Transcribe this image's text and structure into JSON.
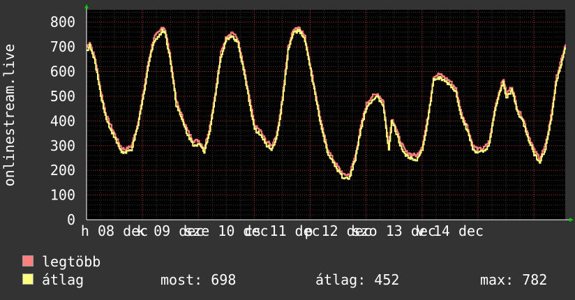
{
  "chart_data": {
    "type": "line",
    "ylabel": "onlinestream.live",
    "ylim": [
      0,
      850
    ],
    "yticks": [
      0,
      100,
      200,
      300,
      400,
      500,
      600,
      700,
      800
    ],
    "xticks": [
      "h 08 dec",
      "k 09 dec",
      "sze 10 dec",
      "cs 11 dec",
      "p 12 dec",
      "szo 13 dec",
      "v 14 dec"
    ],
    "grid": true,
    "series": [
      {
        "name": "legtöbb",
        "color": "#ff7f7f",
        "anchors": [
          [
            0.0,
            700
          ],
          [
            0.05,
            720
          ],
          [
            0.15,
            650
          ],
          [
            0.25,
            520
          ],
          [
            0.35,
            420
          ],
          [
            0.45,
            370
          ],
          [
            0.55,
            320
          ],
          [
            0.62,
            290
          ],
          [
            0.7,
            285
          ],
          [
            0.8,
            300
          ],
          [
            0.9,
            380
          ],
          [
            1.0,
            500
          ],
          [
            1.1,
            640
          ],
          [
            1.2,
            740
          ],
          [
            1.3,
            760
          ],
          [
            1.35,
            785
          ],
          [
            1.4,
            770
          ],
          [
            1.5,
            650
          ],
          [
            1.6,
            480
          ],
          [
            1.7,
            420
          ],
          [
            1.8,
            360
          ],
          [
            1.9,
            320
          ],
          [
            2.0,
            320
          ],
          [
            2.1,
            290
          ],
          [
            2.2,
            380
          ],
          [
            2.3,
            520
          ],
          [
            2.4,
            680
          ],
          [
            2.5,
            745
          ],
          [
            2.6,
            760
          ],
          [
            2.7,
            730
          ],
          [
            2.8,
            620
          ],
          [
            2.9,
            500
          ],
          [
            3.0,
            380
          ],
          [
            3.1,
            360
          ],
          [
            3.2,
            320
          ],
          [
            3.3,
            300
          ],
          [
            3.4,
            350
          ],
          [
            3.5,
            500
          ],
          [
            3.6,
            700
          ],
          [
            3.7,
            775
          ],
          [
            3.8,
            780
          ],
          [
            3.9,
            740
          ],
          [
            4.0,
            620
          ],
          [
            4.1,
            500
          ],
          [
            4.2,
            380
          ],
          [
            4.3,
            290
          ],
          [
            4.4,
            245
          ],
          [
            4.5,
            210
          ],
          [
            4.6,
            180
          ],
          [
            4.7,
            185
          ],
          [
            4.8,
            260
          ],
          [
            4.9,
            380
          ],
          [
            5.0,
            470
          ],
          [
            5.1,
            500
          ],
          [
            5.2,
            510
          ],
          [
            5.3,
            480
          ],
          [
            5.35,
            380
          ],
          [
            5.4,
            300
          ],
          [
            5.45,
            410
          ],
          [
            5.5,
            390
          ],
          [
            5.6,
            320
          ],
          [
            5.7,
            275
          ],
          [
            5.8,
            265
          ],
          [
            5.9,
            260
          ],
          [
            6.0,
            300
          ],
          [
            6.1,
            420
          ],
          [
            6.2,
            580
          ],
          [
            6.3,
            590
          ],
          [
            6.4,
            575
          ],
          [
            6.5,
            560
          ],
          [
            6.6,
            530
          ],
          [
            6.7,
            430
          ],
          [
            6.8,
            380
          ],
          [
            6.9,
            300
          ],
          [
            7.0,
            285
          ],
          [
            7.1,
            290
          ],
          [
            7.2,
            320
          ],
          [
            7.3,
            460
          ],
          [
            7.4,
            540
          ],
          [
            7.45,
            570
          ],
          [
            7.5,
            510
          ],
          [
            7.6,
            540
          ],
          [
            7.7,
            450
          ],
          [
            7.8,
            410
          ],
          [
            7.9,
            340
          ],
          [
            8.0,
            280
          ],
          [
            8.1,
            250
          ],
          [
            8.2,
            300
          ],
          [
            8.3,
            420
          ],
          [
            8.4,
            580
          ],
          [
            8.5,
            660
          ],
          [
            8.56,
            710
          ]
        ]
      },
      {
        "name": "átlag",
        "color": "#ffff7f",
        "anchors": [
          [
            0.0,
            685
          ],
          [
            0.05,
            705
          ],
          [
            0.15,
            635
          ],
          [
            0.25,
            505
          ],
          [
            0.35,
            405
          ],
          [
            0.45,
            355
          ],
          [
            0.55,
            305
          ],
          [
            0.62,
            275
          ],
          [
            0.7,
            270
          ],
          [
            0.8,
            285
          ],
          [
            0.9,
            365
          ],
          [
            1.0,
            485
          ],
          [
            1.1,
            625
          ],
          [
            1.2,
            725
          ],
          [
            1.3,
            745
          ],
          [
            1.35,
            770
          ],
          [
            1.4,
            755
          ],
          [
            1.5,
            635
          ],
          [
            1.6,
            465
          ],
          [
            1.7,
            405
          ],
          [
            1.8,
            345
          ],
          [
            1.9,
            305
          ],
          [
            2.0,
            305
          ],
          [
            2.1,
            275
          ],
          [
            2.2,
            365
          ],
          [
            2.3,
            505
          ],
          [
            2.4,
            665
          ],
          [
            2.5,
            730
          ],
          [
            2.6,
            745
          ],
          [
            2.7,
            715
          ],
          [
            2.8,
            605
          ],
          [
            2.9,
            485
          ],
          [
            3.0,
            365
          ],
          [
            3.1,
            345
          ],
          [
            3.2,
            305
          ],
          [
            3.3,
            285
          ],
          [
            3.4,
            335
          ],
          [
            3.5,
            485
          ],
          [
            3.6,
            685
          ],
          [
            3.7,
            760
          ],
          [
            3.8,
            765
          ],
          [
            3.9,
            725
          ],
          [
            4.0,
            605
          ],
          [
            4.1,
            485
          ],
          [
            4.2,
            365
          ],
          [
            4.3,
            275
          ],
          [
            4.4,
            230
          ],
          [
            4.5,
            195
          ],
          [
            4.6,
            165
          ],
          [
            4.7,
            170
          ],
          [
            4.8,
            245
          ],
          [
            4.9,
            365
          ],
          [
            5.0,
            455
          ],
          [
            5.1,
            485
          ],
          [
            5.2,
            495
          ],
          [
            5.3,
            465
          ],
          [
            5.35,
            365
          ],
          [
            5.4,
            285
          ],
          [
            5.45,
            395
          ],
          [
            5.5,
            375
          ],
          [
            5.6,
            305
          ],
          [
            5.7,
            260
          ],
          [
            5.8,
            250
          ],
          [
            5.9,
            245
          ],
          [
            6.0,
            285
          ],
          [
            6.1,
            405
          ],
          [
            6.2,
            565
          ],
          [
            6.3,
            575
          ],
          [
            6.4,
            560
          ],
          [
            6.5,
            545
          ],
          [
            6.6,
            515
          ],
          [
            6.7,
            415
          ],
          [
            6.8,
            365
          ],
          [
            6.9,
            285
          ],
          [
            7.0,
            270
          ],
          [
            7.1,
            275
          ],
          [
            7.2,
            305
          ],
          [
            7.3,
            445
          ],
          [
            7.4,
            525
          ],
          [
            7.45,
            555
          ],
          [
            7.5,
            495
          ],
          [
            7.6,
            525
          ],
          [
            7.7,
            435
          ],
          [
            7.8,
            395
          ],
          [
            7.9,
            325
          ],
          [
            8.0,
            265
          ],
          [
            8.1,
            235
          ],
          [
            8.2,
            285
          ],
          [
            8.3,
            405
          ],
          [
            8.4,
            565
          ],
          [
            8.5,
            645
          ],
          [
            8.56,
            698
          ]
        ]
      }
    ],
    "xlim": [
      0,
      8.56
    ]
  },
  "legend": {
    "items": [
      {
        "label": "legtöbb",
        "color": "#ff7f7f"
      },
      {
        "label": "átlag",
        "color": "#ffff7f"
      }
    ],
    "stats": {
      "most": "most: 698",
      "atlag": "átlag: 452",
      "max": "max: 782"
    }
  }
}
